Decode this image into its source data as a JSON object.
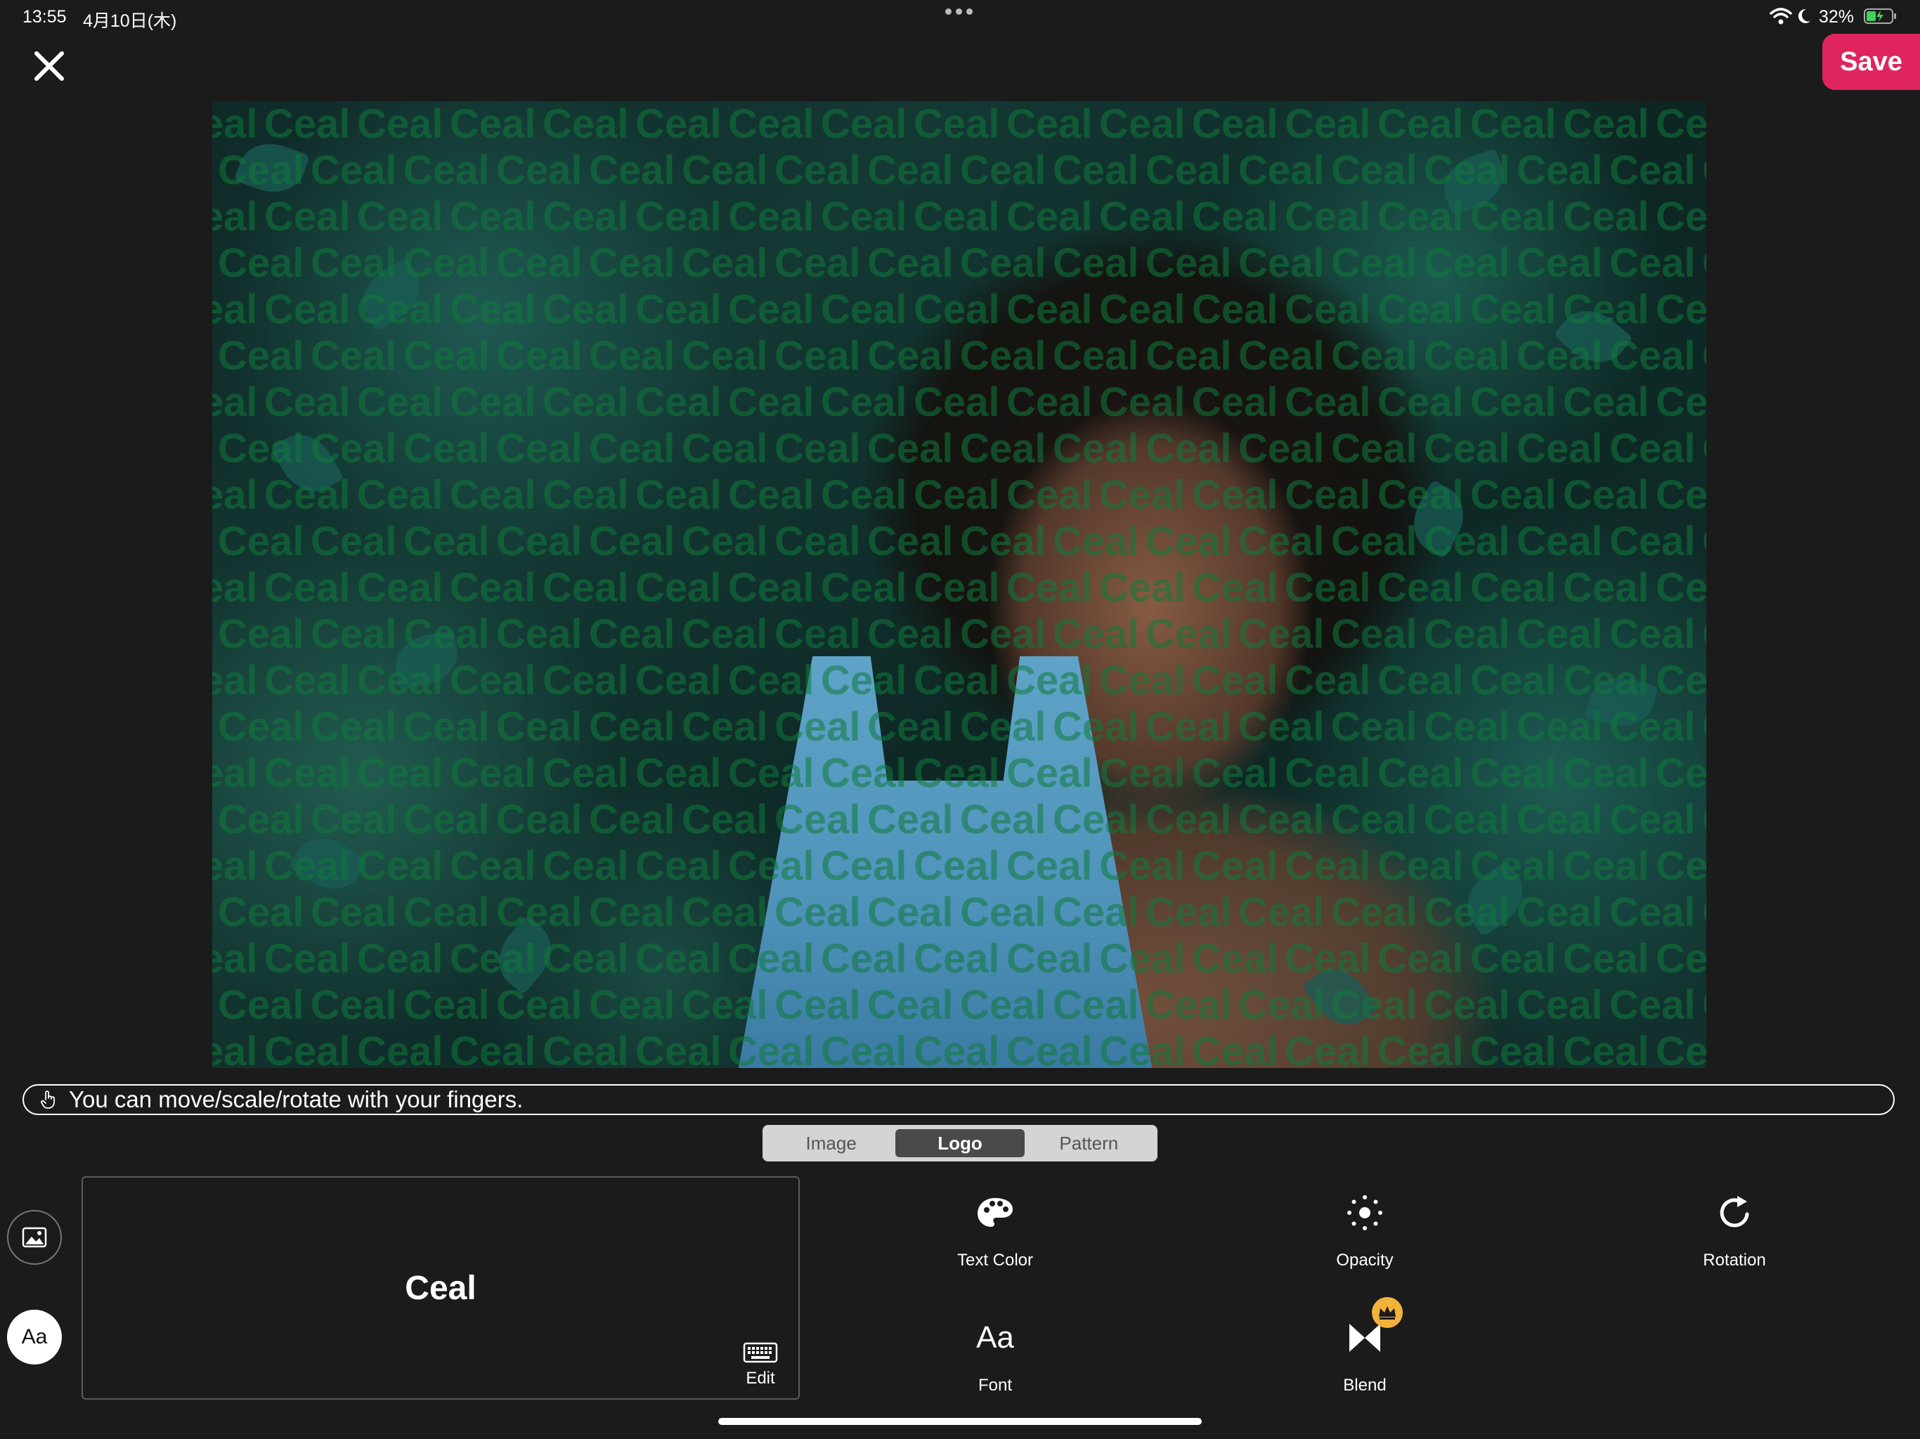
{
  "status_bar": {
    "time": "13:55",
    "date": "4月10日(木)",
    "battery": "32%"
  },
  "header": {
    "close_icon": "close-icon",
    "save_label": "Save",
    "save_color": "#e0245e"
  },
  "watermark": {
    "text": "Ceal",
    "color": "#0f7a3a"
  },
  "hint": {
    "icon": "hand-pointer-icon",
    "text": "You can move/scale/rotate with your fingers."
  },
  "segments": {
    "items": [
      "Image",
      "Logo",
      "Pattern"
    ],
    "active": "Logo"
  },
  "left_buttons": {
    "image_icon": "image-icon",
    "text_label": "Aa"
  },
  "logo_panel": {
    "logo_text": "Ceal",
    "edit_label": "Edit",
    "edit_icon": "keyboard-icon"
  },
  "tools": {
    "text_color": "Text Color",
    "opacity": "Opacity",
    "rotation": "Rotation",
    "font": "Font",
    "font_glyph": "Aa",
    "blend": "Blend"
  }
}
